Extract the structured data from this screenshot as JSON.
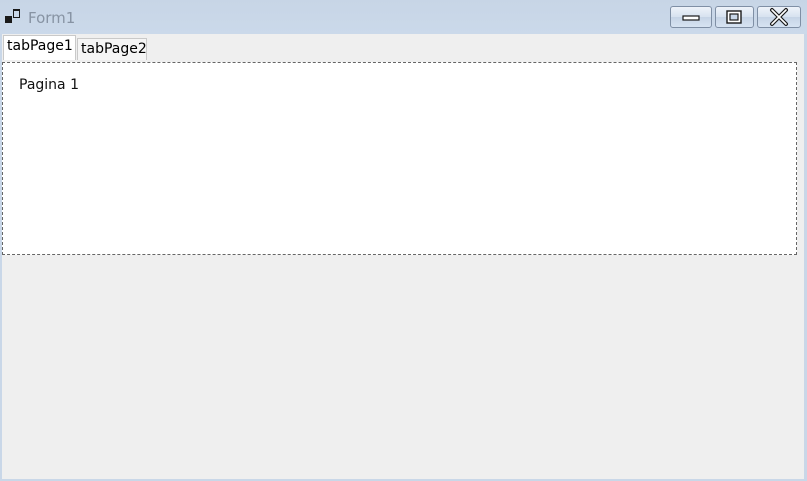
{
  "window": {
    "title": "Form1",
    "icon": "form-app-icon",
    "controls": {
      "minimize": "minimize-icon",
      "maximize": "maximize-icon",
      "close": "close-icon"
    }
  },
  "tabs": [
    {
      "label": "tabPage1",
      "selected": true
    },
    {
      "label": "tabPage2",
      "selected": false
    }
  ],
  "panel": {
    "label": "Pagina 1"
  },
  "colors": {
    "titlebar": "#c9d7e8",
    "client_bg": "#efefef",
    "panel_bg": "#ffffff",
    "title_text": "#8793a3"
  }
}
